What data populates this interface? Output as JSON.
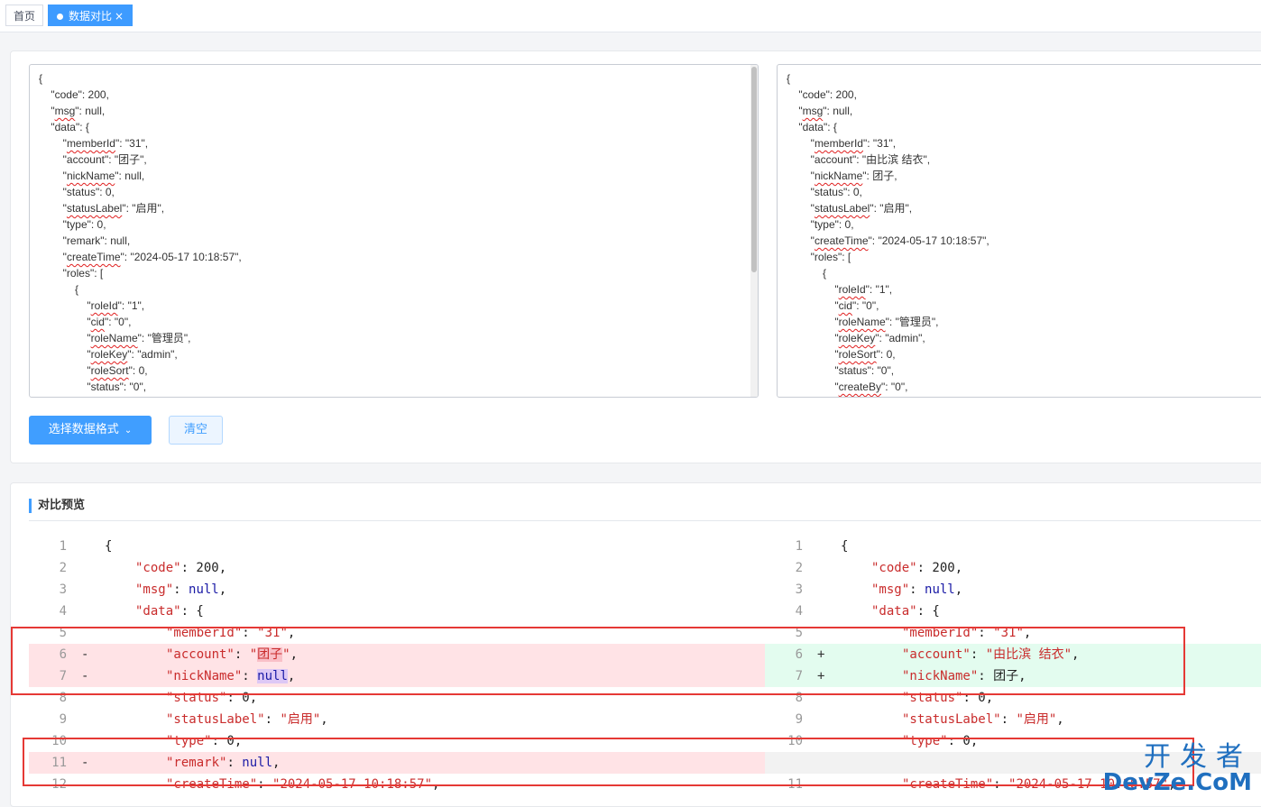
{
  "tabs": [
    {
      "label": "首页"
    },
    {
      "label": "数据对比",
      "close": "×"
    }
  ],
  "left_input_lines": [
    "{",
    "    \"code\": 200,",
    "    \"msg\": null,",
    "    \"data\": {",
    "        \"memberId\": \"31\",",
    "        \"account\": \"团子\",",
    "        \"nickName\": null,",
    "        \"status\": 0,",
    "        \"statusLabel\": \"启用\",",
    "        \"type\": 0,",
    "        \"remark\": null,",
    "        \"createTime\": \"2024-05-17 10:18:57\",",
    "        \"roles\": [",
    "            {",
    "                \"roleId\": \"1\",",
    "                \"cid\": \"0\",",
    "                \"roleName\": \"管理员\",",
    "                \"roleKey\": \"admin\",",
    "                \"roleSort\": 0,",
    "                \"status\": \"0\","
  ],
  "right_input_lines": [
    "{",
    "    \"code\": 200,",
    "    \"msg\": null,",
    "    \"data\": {",
    "        \"memberId\": \"31\",",
    "        \"account\": \"由比滨 结衣\",",
    "        \"nickName\": 团子,",
    "        \"status\": 0,",
    "        \"statusLabel\": \"启用\",",
    "        \"type\": 0,",
    "        \"createTime\": \"2024-05-17 10:18:57\",",
    "        \"roles\": [",
    "            {",
    "                \"roleId\": \"1\",",
    "                \"cid\": \"0\",",
    "                \"roleName\": \"管理员\",",
    "                \"roleKey\": \"admin\",",
    "                \"roleSort\": 0,",
    "                \"status\": \"0\",",
    "                \"createBy\": \"0\","
  ],
  "buttons": {
    "select_format": "选择数据格式",
    "clear": "清空"
  },
  "section_title": "对比预览",
  "diff_left": [
    {
      "num": "1",
      "sign": "",
      "type": "same",
      "indent": 0,
      "parts": [
        [
          "p",
          "{"
        ]
      ]
    },
    {
      "num": "2",
      "sign": "",
      "type": "same",
      "indent": 1,
      "parts": [
        [
          "k",
          "\"code\""
        ],
        [
          "p",
          ": 200,"
        ]
      ]
    },
    {
      "num": "3",
      "sign": "",
      "type": "same",
      "indent": 1,
      "parts": [
        [
          "k",
          "\"msg\""
        ],
        [
          "p",
          ": "
        ],
        [
          "n",
          "null"
        ],
        [
          "p",
          ","
        ]
      ]
    },
    {
      "num": "4",
      "sign": "",
      "type": "same",
      "indent": 1,
      "parts": [
        [
          "k",
          "\"data\""
        ],
        [
          "p",
          ": {"
        ]
      ]
    },
    {
      "num": "5",
      "sign": "",
      "type": "same",
      "indent": 2,
      "parts": [
        [
          "k",
          "\"memberId\""
        ],
        [
          "p",
          ": "
        ],
        [
          "s",
          "\"31\""
        ],
        [
          "p",
          ","
        ]
      ]
    },
    {
      "num": "6",
      "sign": "-",
      "type": "del",
      "indent": 2,
      "parts": [
        [
          "k",
          "\"account\""
        ],
        [
          "p",
          ": "
        ],
        [
          "s",
          "\""
        ],
        [
          "hd",
          "团子"
        ],
        [
          "s",
          "\""
        ],
        [
          "p",
          ","
        ]
      ]
    },
    {
      "num": "7",
      "sign": "-",
      "type": "del",
      "indent": 2,
      "parts": [
        [
          "k",
          "\"nickName\""
        ],
        [
          "p",
          ": "
        ],
        [
          "hn",
          "null"
        ],
        [
          "p",
          ","
        ]
      ]
    },
    {
      "num": "8",
      "sign": "",
      "type": "same",
      "indent": 2,
      "parts": [
        [
          "k",
          "\"status\""
        ],
        [
          "p",
          ": 0,"
        ]
      ]
    },
    {
      "num": "9",
      "sign": "",
      "type": "same",
      "indent": 2,
      "parts": [
        [
          "k",
          "\"statusLabel\""
        ],
        [
          "p",
          ": "
        ],
        [
          "s",
          "\"启用\""
        ],
        [
          "p",
          ","
        ]
      ]
    },
    {
      "num": "10",
      "sign": "",
      "type": "same",
      "indent": 2,
      "parts": [
        [
          "k",
          "\"type\""
        ],
        [
          "p",
          ": 0,"
        ]
      ]
    },
    {
      "num": "11",
      "sign": "-",
      "type": "del",
      "indent": 2,
      "parts": [
        [
          "k",
          "\"remark\""
        ],
        [
          "p",
          ": "
        ],
        [
          "n",
          "null"
        ],
        [
          "p",
          ","
        ]
      ]
    },
    {
      "num": "12",
      "sign": "",
      "type": "same",
      "indent": 2,
      "parts": [
        [
          "k",
          "\"createTime\""
        ],
        [
          "p",
          ": "
        ],
        [
          "s",
          "\"2024-05-17 10:18:57\""
        ],
        [
          "p",
          ","
        ]
      ]
    }
  ],
  "diff_right": [
    {
      "num": "1",
      "sign": "",
      "type": "same",
      "indent": 0,
      "parts": [
        [
          "p",
          "{"
        ]
      ]
    },
    {
      "num": "2",
      "sign": "",
      "type": "same",
      "indent": 1,
      "parts": [
        [
          "k",
          "\"code\""
        ],
        [
          "p",
          ": 200,"
        ]
      ]
    },
    {
      "num": "3",
      "sign": "",
      "type": "same",
      "indent": 1,
      "parts": [
        [
          "k",
          "\"msg\""
        ],
        [
          "p",
          ": "
        ],
        [
          "n",
          "null"
        ],
        [
          "p",
          ","
        ]
      ]
    },
    {
      "num": "4",
      "sign": "",
      "type": "same",
      "indent": 1,
      "parts": [
        [
          "k",
          "\"data\""
        ],
        [
          "p",
          ": {"
        ]
      ]
    },
    {
      "num": "5",
      "sign": "",
      "type": "same",
      "indent": 2,
      "parts": [
        [
          "k",
          "\"memberId\""
        ],
        [
          "p",
          ": "
        ],
        [
          "s",
          "\"31\""
        ],
        [
          "p",
          ","
        ]
      ]
    },
    {
      "num": "6",
      "sign": "+",
      "type": "add",
      "indent": 2,
      "parts": [
        [
          "k",
          "\"account\""
        ],
        [
          "p",
          ": "
        ],
        [
          "s",
          "\"由比滨 结衣\""
        ],
        [
          "p",
          ","
        ]
      ]
    },
    {
      "num": "7",
      "sign": "+",
      "type": "add",
      "indent": 2,
      "parts": [
        [
          "k",
          "\"nickName\""
        ],
        [
          "p",
          ": 团子,"
        ]
      ]
    },
    {
      "num": "8",
      "sign": "",
      "type": "same",
      "indent": 2,
      "parts": [
        [
          "k",
          "\"status\""
        ],
        [
          "p",
          ": 0,"
        ]
      ]
    },
    {
      "num": "9",
      "sign": "",
      "type": "same",
      "indent": 2,
      "parts": [
        [
          "k",
          "\"statusLabel\""
        ],
        [
          "p",
          ": "
        ],
        [
          "s",
          "\"启用\""
        ],
        [
          "p",
          ","
        ]
      ]
    },
    {
      "num": "10",
      "sign": "",
      "type": "same",
      "indent": 2,
      "parts": [
        [
          "k",
          "\"type\""
        ],
        [
          "p",
          ": 0,"
        ]
      ]
    },
    {
      "num": "",
      "sign": "",
      "type": "empty",
      "indent": 0,
      "parts": []
    },
    {
      "num": "11",
      "sign": "",
      "type": "same",
      "indent": 2,
      "parts": [
        [
          "k",
          "\"createTime\""
        ],
        [
          "p",
          ": "
        ],
        [
          "s",
          "\"2024-05-17 10:18:57\""
        ],
        [
          "p",
          ","
        ]
      ]
    }
  ],
  "watermark": {
    "cn": "开发者",
    "en": "DevZe.CoM"
  },
  "colors": {
    "accent": "#409eff",
    "deleted_bg": "#ffe3e6",
    "added_bg": "#e3fcef",
    "highlight_box": "#e53935"
  }
}
